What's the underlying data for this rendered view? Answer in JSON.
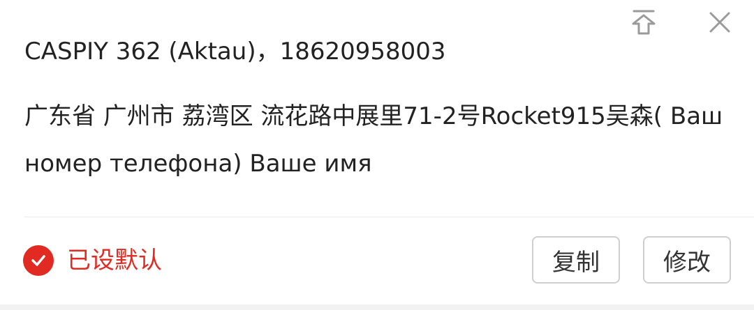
{
  "address": {
    "recipient_line": "CASPIY 362 (Aktau)，18620958003",
    "address_line": "广东省 广州市 荔湾区 流花路中展里71-2号Rocket915吴森( Ваш номер телефона) Ваше имя"
  },
  "footer": {
    "default_label": "已设默认",
    "copy_label": "复制",
    "edit_label": "修改"
  },
  "icons": {
    "pin_top": "pin-to-top-icon",
    "close": "close-icon",
    "check": "check-circle-icon"
  },
  "colors": {
    "accent": "#e02a22",
    "text": "#222222",
    "icon_gray": "#9a9a9a"
  }
}
